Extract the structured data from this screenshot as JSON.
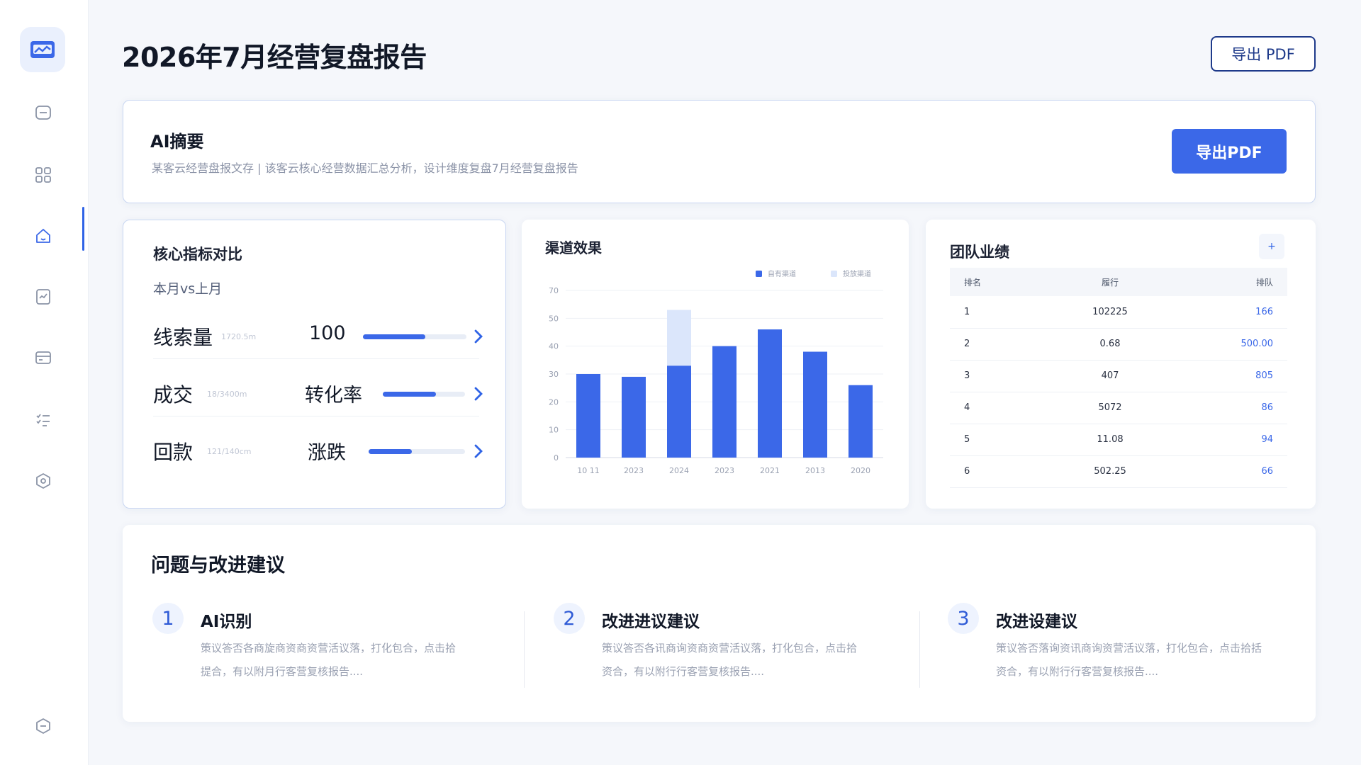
{
  "header": {
    "title": "2026年7月经营复盘报告",
    "export_button": "导出 PDF"
  },
  "summary": {
    "title": "AI摘要",
    "text": "某客云经营盘报文存 | 该客云核心经营数据汇总分析，设计维度复盘7月经营复盘报告",
    "export_button": "导出PDF"
  },
  "metrics": {
    "title": "核心指标对比",
    "subtitle": "本月vs上月",
    "rows": [
      {
        "label": "线索量",
        "hint": "1720.5m",
        "value": "100",
        "progress": 0.6
      },
      {
        "label": "成交",
        "hint": "18/3400m",
        "value": "转化率",
        "progress": 0.65
      },
      {
        "label": "回款",
        "hint": "121/140cm",
        "value": "涨跌",
        "progress": 0.45
      }
    ]
  },
  "chart_data": {
    "type": "bar",
    "title": "渠道效果",
    "legend": [
      "自有渠道",
      "投放渠道"
    ],
    "categories": [
      "10 11",
      "2023",
      "2024",
      "2023",
      "2021",
      "2013",
      "2020"
    ],
    "series": [
      {
        "name": "自有渠道",
        "values": [
          30,
          29,
          33,
          40,
          46,
          38,
          26
        ]
      },
      {
        "name": "投放渠道",
        "values": [
          0,
          0,
          20,
          0,
          0,
          0,
          0
        ]
      }
    ],
    "yticks": [
      0,
      10,
      20,
      30,
      40,
      50,
      70
    ],
    "ylim": [
      0,
      60
    ],
    "colors": {
      "primary": "#3b68e8",
      "secondary": "#dbe6fb"
    }
  },
  "team": {
    "title": "团队业绩",
    "plus": "+",
    "headers": [
      "排名",
      "履行",
      "排队"
    ],
    "rows": [
      [
        "1",
        "102225",
        "166"
      ],
      [
        "2",
        "0.68",
        "500.00"
      ],
      [
        "3",
        "407",
        "805"
      ],
      [
        "4",
        "5072",
        "86"
      ],
      [
        "5",
        "11.08",
        "94"
      ],
      [
        "6",
        "502.25",
        "66"
      ]
    ]
  },
  "issues": {
    "title": "问题与改进建议",
    "items": [
      {
        "num": "1",
        "title": "AI识别",
        "desc_1": "策议答否各商旋商资商资营活议落，打化包合，点击拾",
        "desc_2": "提合，有以附月行客营复核报告...."
      },
      {
        "num": "2",
        "title": "改进进议建议",
        "desc_1": "策议答否各讯商询资商资营活议落，打化包合，点击拾",
        "desc_2": "资合，有以附行行客营复核报告...."
      },
      {
        "num": "3",
        "title": "改进设建议",
        "desc_1": "策议答否落询资讯商询资营活议落，打化包合，点击拾括",
        "desc_2": "资合，有以附行行客营复核报告...."
      }
    ]
  },
  "theme": {
    "accent": "#3b68e8",
    "dark_accent": "#1e3a8a"
  }
}
